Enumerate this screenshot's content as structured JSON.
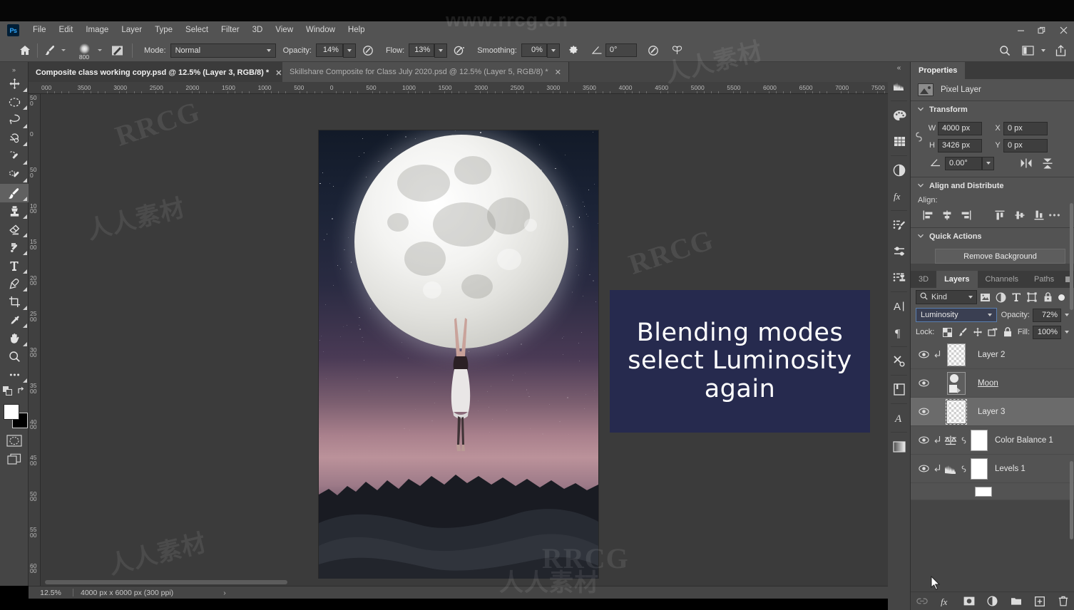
{
  "app": {
    "name": "Adobe Photoshop",
    "logo_text": "Ps"
  },
  "watermarks": {
    "top": "www.rrcg.cn",
    "rrcg": "RRCG",
    "cn": "人人素材",
    "bottom_left": "人人素材",
    "bottom_center": "人人素材"
  },
  "menubar": {
    "items": [
      "File",
      "Edit",
      "Image",
      "Layer",
      "Type",
      "Select",
      "Filter",
      "3D",
      "View",
      "Window",
      "Help"
    ],
    "window_controls": {
      "minimize": "–",
      "restore": "❐",
      "close": "✕"
    }
  },
  "options_bar": {
    "home_icon": "home-icon",
    "brush_preset_icon": "brush-icon",
    "brush_size": "800",
    "brush_panel_icon": "brush-settings-icon",
    "mode_label": "Mode:",
    "mode_value": "Normal",
    "opacity_label": "Opacity:",
    "opacity_value": "14%",
    "pressure_opacity_icon": "pressure-opacity-icon",
    "flow_label": "Flow:",
    "flow_value": "13%",
    "airbrush_icon": "airbrush-icon",
    "smoothing_label": "Smoothing:",
    "smoothing_value": "0%",
    "smoothing_gear_icon": "gear-icon",
    "angle_icon": "angle-icon",
    "angle_value": "0°",
    "pressure_size_icon": "pressure-size-icon",
    "symmetry_icon": "butterfly-symmetry-icon",
    "search_icon": "search-icon",
    "workspace_icon": "workspace-icon",
    "share_icon": "share-icon"
  },
  "tabs": [
    {
      "label": "Composite class working copy.psd @ 12.5% (Layer 3, RGB/8) *",
      "active": true,
      "close": "✕"
    },
    {
      "label": "Skillshare Composite for Class July 2020.psd @ 12.5% (Layer 5, RGB/8) *",
      "active": false,
      "close": "✕"
    }
  ],
  "toolbar": {
    "tools": [
      {
        "name": "move-tool",
        "selected": false
      },
      {
        "name": "marquee-tool",
        "selected": false
      },
      {
        "name": "lasso-tool",
        "selected": false
      },
      {
        "name": "object-selection-tool",
        "selected": false
      },
      {
        "name": "crop-quick-tool",
        "selected": false
      },
      {
        "name": "healing-brush-tool",
        "selected": false
      },
      {
        "name": "brush-tool",
        "selected": true
      },
      {
        "name": "clone-stamp-tool",
        "selected": false
      },
      {
        "name": "eraser-tool",
        "selected": false
      },
      {
        "name": "gradient-tool",
        "selected": false
      },
      {
        "name": "type-tool",
        "selected": false
      },
      {
        "name": "pen-tool",
        "selected": false
      },
      {
        "name": "crop-tool",
        "selected": false
      },
      {
        "name": "eyedropper-tool",
        "selected": false
      },
      {
        "name": "hand-tool",
        "selected": false
      },
      {
        "name": "zoom-tool",
        "selected": false
      },
      {
        "name": "edit-toolbar-tool",
        "selected": false
      }
    ],
    "foreground_color": "#ffffff",
    "background_color": "#000000",
    "quick_mask_icon": "quick-mask-icon",
    "screen_mode_icon": "screen-mode-icon"
  },
  "rulers": {
    "horizontal": [
      "000",
      "3500",
      "3000",
      "2500",
      "2000",
      "1500",
      "1000",
      "500",
      "0",
      "500",
      "1000",
      "1500",
      "2000",
      "2500",
      "3000",
      "3500",
      "4000",
      "4500",
      "5000",
      "5500",
      "6000",
      "6500",
      "7000",
      "7500"
    ],
    "vertical": [
      "500",
      "0",
      "500",
      "1000",
      "1500",
      "2000",
      "2500",
      "3000",
      "3500",
      "4000",
      "4500",
      "5000",
      "5500",
      "6000"
    ]
  },
  "callout": {
    "lines": [
      "Blending modes",
      "select Luminosity",
      "again"
    ],
    "bg_color": "#262a4e",
    "text_color": "#ffffff"
  },
  "status_bar": {
    "zoom": "12.5%",
    "dimensions": "4000 px x 6000 px (300 ppi)",
    "arrow": "›"
  },
  "dock_icons": [
    {
      "name": "histogram-icon"
    },
    {
      "name": "color-icon"
    },
    {
      "name": "swatches-icon"
    },
    {
      "name": "adjustments-icon"
    },
    {
      "name": "layer-styles-fx-icon"
    },
    {
      "name": "brush-settings-icon"
    },
    {
      "name": "brushes-icon"
    },
    {
      "name": "clone-source-icon"
    },
    {
      "name": "character-icon"
    },
    {
      "name": "paragraph-icon"
    },
    {
      "name": "tool-presets-icon"
    },
    {
      "name": "libraries-icon"
    },
    {
      "name": "glyphs-icon"
    },
    {
      "name": "gradients-icon"
    }
  ],
  "properties": {
    "tab_label": "Properties",
    "layer_type_icon": "pixel-layer-icon",
    "layer_type": "Pixel Layer",
    "transform": {
      "title": "Transform",
      "link_icon": "link-icon",
      "w_label": "W",
      "w_value": "4000 px",
      "h_label": "H",
      "h_value": "3426 px",
      "x_label": "X",
      "x_value": "0 px",
      "y_label": "Y",
      "y_value": "0 px",
      "angle_icon": "angle-icon",
      "angle_value": "0.00°",
      "flip_horizontal_icon": "flip-horizontal-icon",
      "flip_vertical_icon": "flip-vertical-icon"
    },
    "align": {
      "title": "Align and Distribute",
      "label": "Align:",
      "buttons": [
        "align-left-edges-icon",
        "align-horizontal-centers-icon",
        "align-right-edges-icon",
        "align-top-edges-icon",
        "align-vertical-centers-icon",
        "align-bottom-edges-icon"
      ],
      "more_icon": "more-options-icon"
    },
    "quick_actions": {
      "title": "Quick Actions",
      "remove_background": "Remove Background"
    }
  },
  "layers_panel": {
    "tabs": [
      {
        "label": "3D",
        "active": false
      },
      {
        "label": "Layers",
        "active": true
      },
      {
        "label": "Channels",
        "active": false
      },
      {
        "label": "Paths",
        "active": false
      }
    ],
    "filter": {
      "search_icon": "search-icon",
      "kind_label": "Kind",
      "icons": [
        "filter-pixel-icon",
        "filter-adjustment-icon",
        "filter-type-icon",
        "filter-shape-icon",
        "filter-smart-object-icon"
      ],
      "toggle": "filter-enable-toggle"
    },
    "blend_mode": "Luminosity",
    "opacity_label": "Opacity:",
    "opacity_value": "72%",
    "lock_label": "Lock:",
    "lock_icons": [
      "lock-transparent-pixels-icon",
      "lock-image-pixels-icon",
      "lock-position-icon",
      "lock-artboard-nesting-icon",
      "lock-all-icon"
    ],
    "fill_label": "Fill:",
    "fill_value": "100%",
    "layers": [
      {
        "name": "Layer 2",
        "visible": true,
        "clipped": true,
        "selected": false,
        "type": "pixel",
        "thumb": "transparent"
      },
      {
        "name": "Moon ",
        "visible": true,
        "clipped": false,
        "selected": false,
        "type": "pixel",
        "thumb": "image",
        "underlined": true
      },
      {
        "name": "Layer 3",
        "visible": true,
        "clipped": false,
        "selected": true,
        "type": "pixel",
        "thumb": "transparent"
      },
      {
        "name": "Color Balance 1",
        "visible": true,
        "clipped": true,
        "selected": false,
        "type": "adjustment",
        "adj_icon": "color-balance-icon",
        "mask": true
      },
      {
        "name": "Levels 1",
        "visible": true,
        "clipped": true,
        "selected": false,
        "type": "adjustment",
        "adj_icon": "levels-icon",
        "mask": true
      }
    ],
    "bottom_tools": [
      "link-layers-icon",
      "layer-style-fx-icon",
      "add-layer-mask-icon",
      "new-adjustment-layer-icon",
      "new-group-icon",
      "new-layer-icon",
      "delete-layer-icon"
    ]
  }
}
